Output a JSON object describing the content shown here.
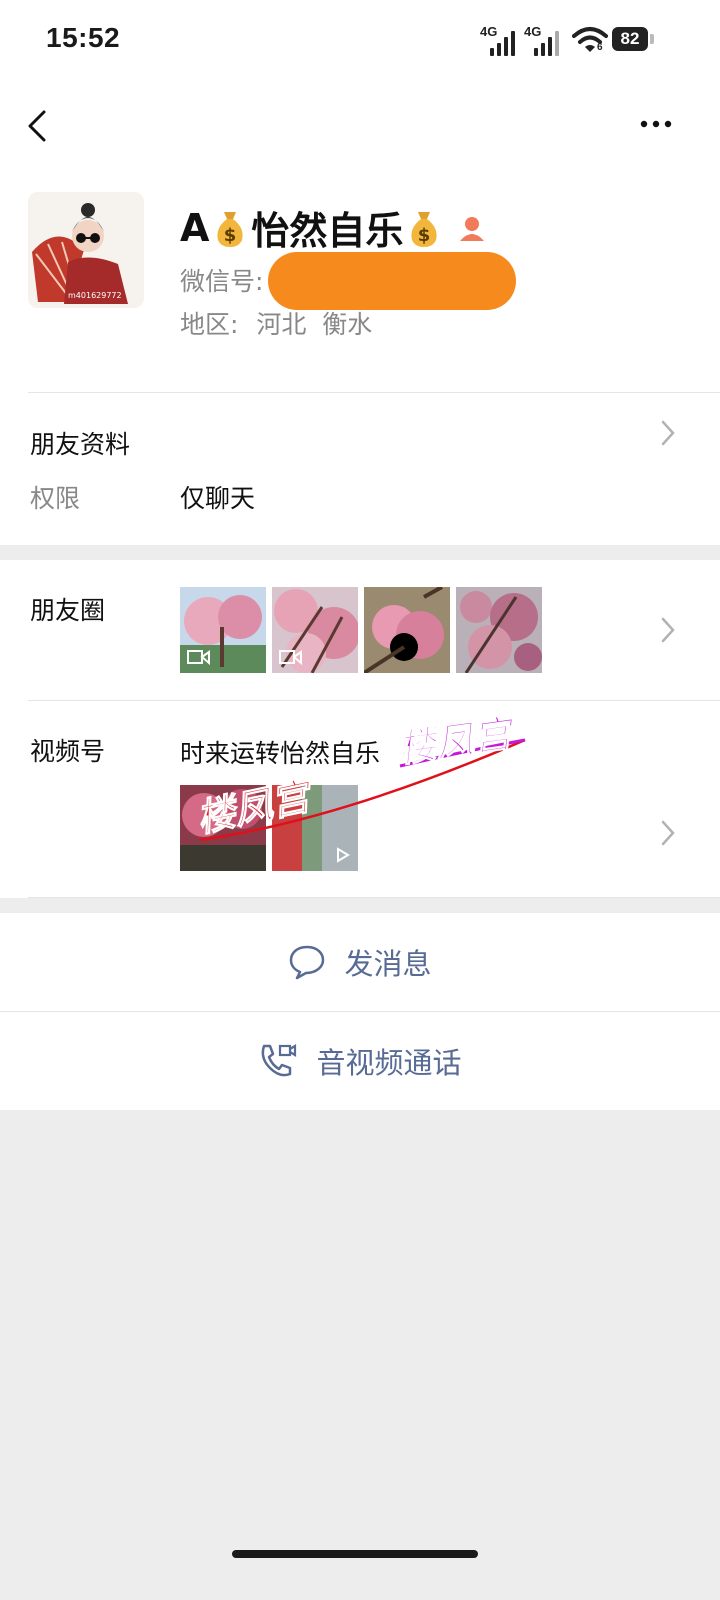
{
  "status_bar": {
    "time": "15:52",
    "signal1": "4G",
    "signal2": "4G",
    "wifi_badge": "6",
    "battery": "82"
  },
  "profile": {
    "name_prefix": "A",
    "name_main": "怡然自乐",
    "wechat_id_label": "微信号:",
    "region_label": "地区:",
    "region_value": "河北  衡水",
    "avatar_watermark": "m401629772"
  },
  "friend_info": {
    "title": "朋友资料",
    "permission_label": "权限",
    "permission_value": "仅聊天"
  },
  "moments": {
    "label": "朋友圈"
  },
  "channels": {
    "label": "视频号",
    "title": "时来运转怡然自乐"
  },
  "watermark_text": "楼凤宫",
  "actions": {
    "message": "发消息",
    "call": "音视频通话"
  },
  "colors": {
    "link_blue": "#576b95",
    "redaction_orange": "#f78a1d",
    "watermark_red": "#e0101a",
    "watermark_purple": "#c21ad6"
  }
}
